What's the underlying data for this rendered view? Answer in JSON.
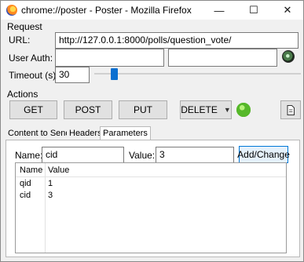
{
  "window": {
    "title": "chrome://poster - Poster - Mozilla Firefox",
    "controls": {
      "minimize": "—",
      "maximize": "☐",
      "close": "✕"
    }
  },
  "request": {
    "section_label": "Request",
    "url_label": "URL:",
    "url_value": "http://127.0.0.1:8000/polls/question_vote/",
    "user_auth_label": "User Auth:",
    "user_value": "",
    "password_value": "",
    "timeout_label": "Timeout (s):",
    "timeout_value": "30",
    "timeout_slider_fraction": 0.08
  },
  "actions": {
    "section_label": "Actions",
    "get_label": "GET",
    "post_label": "POST",
    "put_label": "PUT",
    "method_select_value": "DELETE",
    "status_color": "#56b82a"
  },
  "tabs": [
    {
      "label": "Content to Send",
      "active": false
    },
    {
      "label": "Headers",
      "active": false
    },
    {
      "label": "Parameters",
      "active": true
    }
  ],
  "parameters": {
    "name_label": "Name:",
    "name_value": "cid",
    "value_label": "Value:",
    "value_value": "3",
    "add_change_label": "Add/Change",
    "columns": [
      "Name",
      "Value"
    ],
    "rows": [
      {
        "name": "qid",
        "value": "1"
      },
      {
        "name": "cid",
        "value": "3"
      }
    ]
  }
}
